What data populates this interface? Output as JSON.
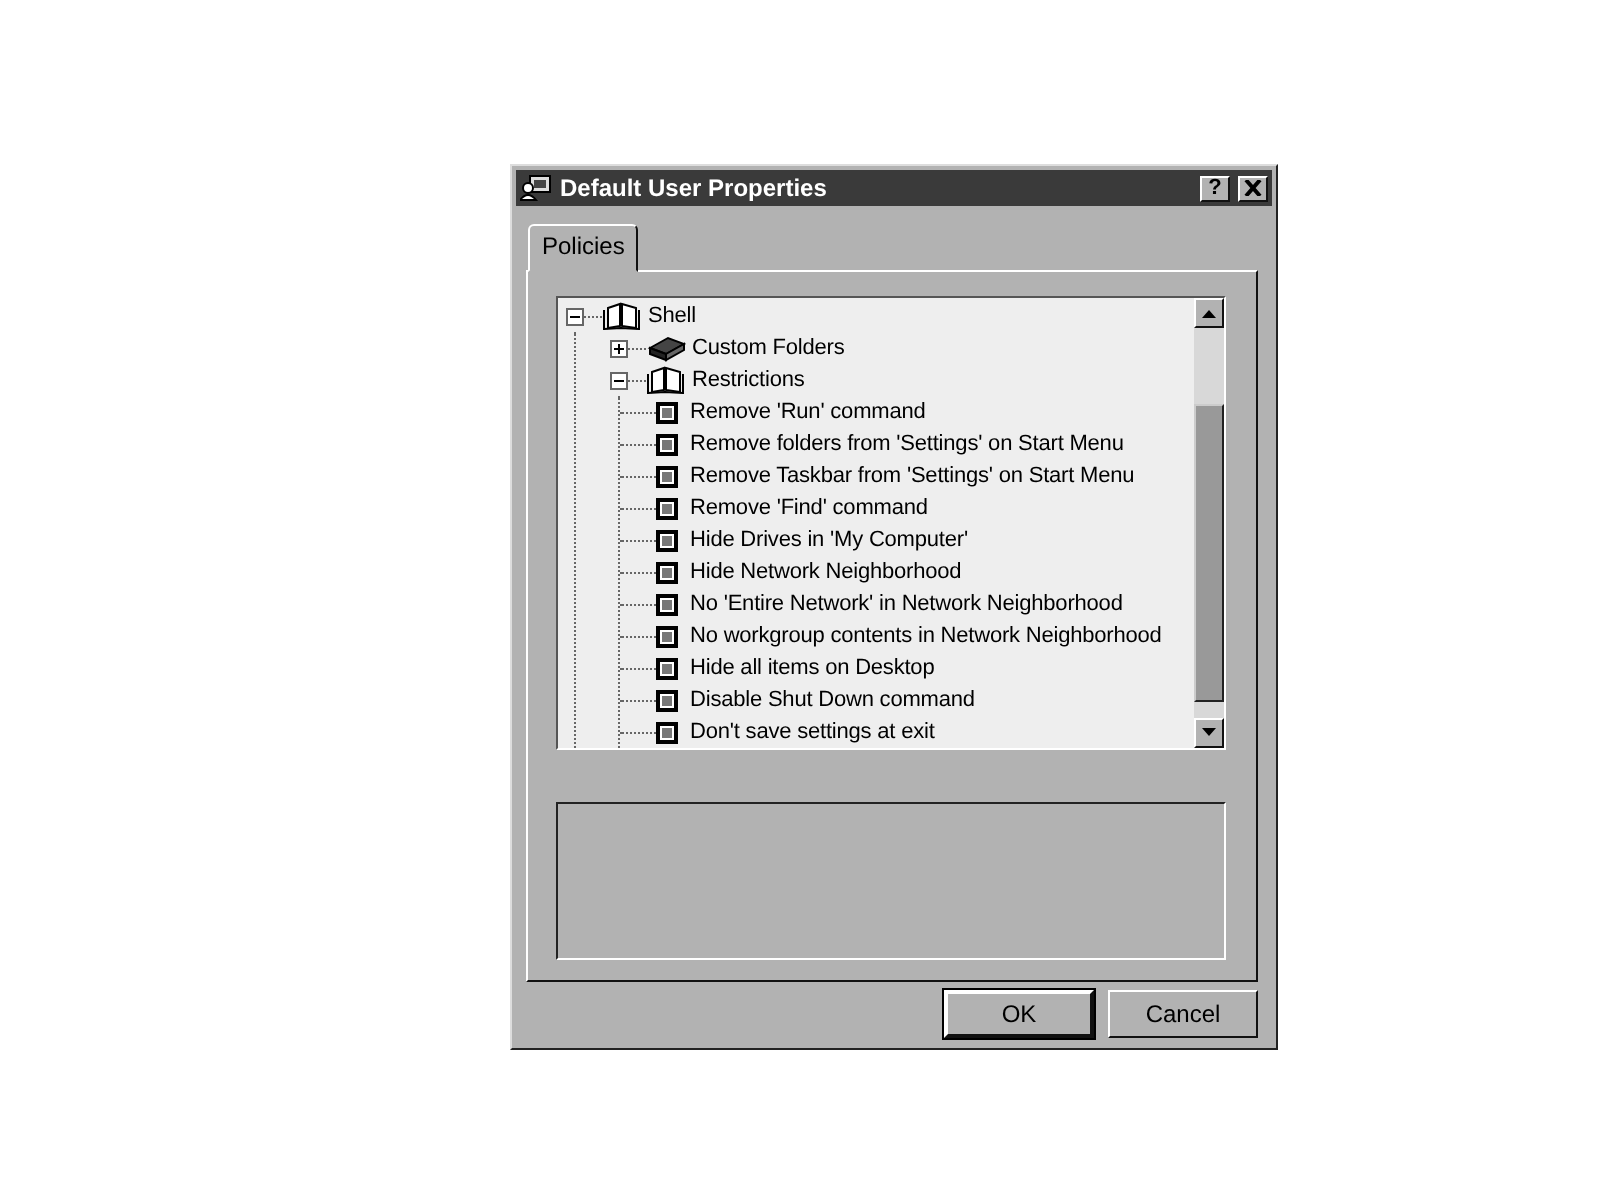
{
  "window": {
    "title": "Default User Properties",
    "help_button": "?"
  },
  "tabs": [
    {
      "label": "Policies",
      "selected": true
    }
  ],
  "tree": [
    {
      "label": "Shell",
      "kind": "folder",
      "expanded": true,
      "children": [
        {
          "label": "Custom Folders",
          "kind": "folder",
          "expanded": false
        },
        {
          "label": "Restrictions",
          "kind": "folder",
          "expanded": true,
          "children": [
            {
              "label": "Remove 'Run' command",
              "kind": "policy",
              "grayed": true
            },
            {
              "label": "Remove folders from 'Settings' on Start Menu",
              "kind": "policy",
              "grayed": true
            },
            {
              "label": "Remove Taskbar from 'Settings' on Start Menu",
              "kind": "policy",
              "grayed": true
            },
            {
              "label": "Remove 'Find' command",
              "kind": "policy",
              "grayed": true
            },
            {
              "label": "Hide Drives in 'My Computer'",
              "kind": "policy",
              "grayed": true
            },
            {
              "label": "Hide Network Neighborhood",
              "kind": "policy",
              "grayed": true
            },
            {
              "label": "No 'Entire Network' in Network Neighborhood",
              "kind": "policy",
              "grayed": true
            },
            {
              "label": "No workgroup contents in Network Neighborhood",
              "kind": "policy",
              "grayed": true
            },
            {
              "label": "Hide all items on Desktop",
              "kind": "policy",
              "grayed": true
            },
            {
              "label": "Disable Shut Down command",
              "kind": "policy",
              "grayed": true
            },
            {
              "label": "Don't save settings at exit",
              "kind": "policy",
              "grayed": true
            }
          ]
        }
      ]
    }
  ],
  "buttons": [
    {
      "label": "OK",
      "default": true
    },
    {
      "label": "Cancel",
      "default": false
    }
  ]
}
